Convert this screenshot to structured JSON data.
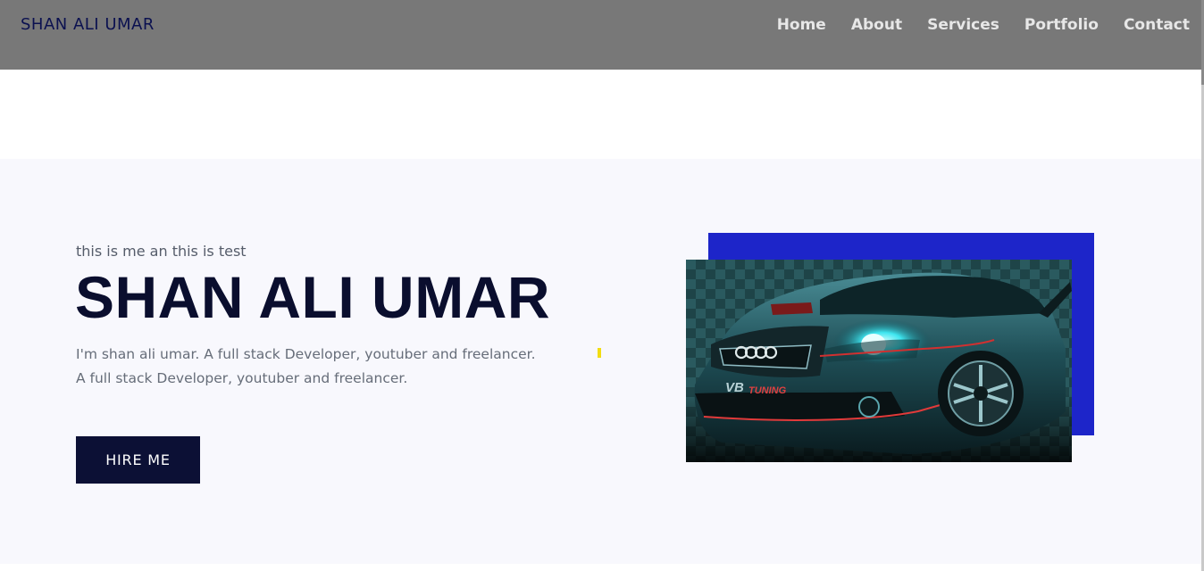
{
  "navbar": {
    "brand": "SHAN ALI UMAR",
    "links": [
      "Home",
      "About",
      "Services",
      "Portfolio",
      "Contact"
    ]
  },
  "hero": {
    "subtitle": "this is me an this is test",
    "title": "SHAN ALI UMAR",
    "description": "I'm shan ali umar. A full stack Developer, youtuber and freelancer. A full stack Developer, youtuber and freelancer.",
    "button_label": "HIRE ME"
  },
  "colors": {
    "navbar_bg": "#787878",
    "brand_text": "#0b1150",
    "hero_bg": "#f8f8fd",
    "title_text": "#0a0e2e",
    "button_bg": "#0c1035",
    "accent_blue": "#1d25c9",
    "accent_yellow": "#f2dd12"
  }
}
